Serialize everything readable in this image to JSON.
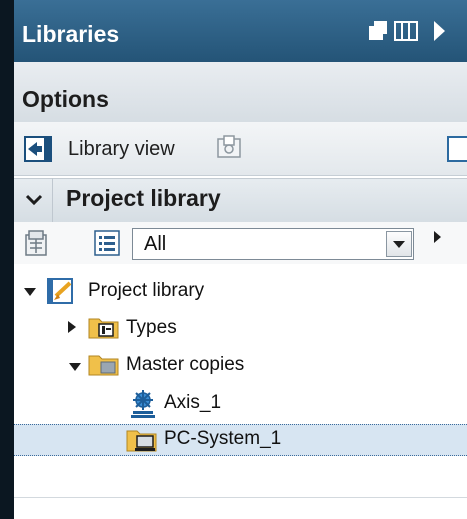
{
  "header": {
    "title": "Libraries"
  },
  "options": {
    "label": "Options"
  },
  "library_view": {
    "label": "Library view"
  },
  "project_library_section": {
    "title": "Project library",
    "filter": {
      "selected": "All"
    }
  },
  "tree": {
    "root": "Project library",
    "items": [
      {
        "label": "Types"
      },
      {
        "label": "Master copies"
      },
      {
        "label": "Axis_1"
      },
      {
        "label": "PC-System_1"
      }
    ]
  },
  "icons": [
    "float-window-icon",
    "split-view-icon",
    "collapse-arrow-icon",
    "library-view-icon",
    "open-library-icon",
    "layout-icon",
    "chevron-down-icon",
    "library-settings-icon",
    "list-view-icon",
    "dropdown-arrow-icon",
    "expand-arrow-icon",
    "project-library-icon",
    "types-folder-icon",
    "master-copies-folder-icon",
    "axis-icon",
    "pc-system-icon"
  ]
}
